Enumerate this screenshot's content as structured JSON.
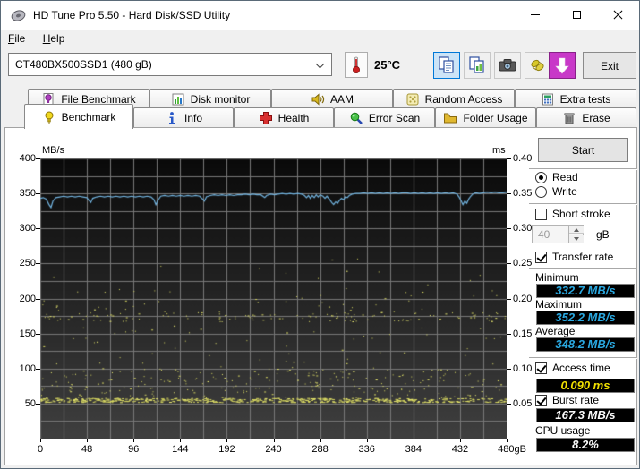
{
  "window": {
    "title": "HD Tune Pro 5.50 - Hard Disk/SSD Utility"
  },
  "menu": {
    "items": [
      "File",
      "Help"
    ]
  },
  "toolbar": {
    "device_select": {
      "value": "CT480BX500SSD1 (480 gB)"
    },
    "temperature": "25°C",
    "buttons": [
      "copy-icon",
      "copy-image-icon",
      "camera-icon",
      "hands-icon",
      "download-icon"
    ],
    "exit_label": "Exit"
  },
  "tabs": {
    "back_row": [
      {
        "label": "File Benchmark",
        "icon": "file-benchmark-icon"
      },
      {
        "label": "Disk monitor",
        "icon": "disk-monitor-icon"
      },
      {
        "label": "AAM",
        "icon": "aam-icon"
      },
      {
        "label": "Random Access",
        "icon": "random-access-icon"
      },
      {
        "label": "Extra tests",
        "icon": "extra-tests-icon"
      }
    ],
    "front_row": [
      {
        "label": "Benchmark",
        "icon": "benchmark-icon",
        "active": true
      },
      {
        "label": "Info",
        "icon": "info-icon"
      },
      {
        "label": "Health",
        "icon": "health-icon"
      },
      {
        "label": "Error Scan",
        "icon": "error-scan-icon"
      },
      {
        "label": "Folder Usage",
        "icon": "folder-usage-icon"
      },
      {
        "label": "Erase",
        "icon": "erase-icon"
      }
    ]
  },
  "controls": {
    "start_label": "Start",
    "read_label": "Read",
    "write_label": "Write",
    "read_selected": true,
    "short_stroke": {
      "label": "Short stroke",
      "checked": false,
      "size_value": "40",
      "size_unit": "gB"
    },
    "transfer_rate": {
      "label": "Transfer rate",
      "checked": true
    },
    "minimum": {
      "label": "Minimum",
      "value": "332.7 MB/s"
    },
    "maximum": {
      "label": "Maximum",
      "value": "352.2 MB/s"
    },
    "average": {
      "label": "Average",
      "value": "348.2 MB/s"
    },
    "access_time": {
      "label": "Access time",
      "checked": true,
      "value": "0.090 ms"
    },
    "burst_rate": {
      "label": "Burst rate",
      "checked": true,
      "value": "167.3 MB/s"
    },
    "cpu_usage": {
      "label": "CPU usage",
      "value": "8.2%"
    }
  },
  "chart_data": {
    "type": "line",
    "title": "",
    "x_axis": {
      "min": 0,
      "max": 480,
      "ticks": [
        0,
        48,
        96,
        144,
        192,
        240,
        288,
        336,
        384,
        432,
        480
      ],
      "unit": "gB",
      "grid_step": 24
    },
    "y_axis_left": {
      "label": "MB/s",
      "min": 0,
      "max": 400,
      "ticks": [
        400,
        350,
        300,
        250,
        200,
        150,
        100,
        50
      ],
      "grid_step": 25
    },
    "y_axis_right": {
      "label": "ms",
      "min": 0,
      "max": 0.4,
      "tick_labels": [
        "0.40",
        "0.35",
        "0.30",
        "0.25",
        "0.20",
        "0.15",
        "0.10",
        "0.05"
      ]
    },
    "grid": true,
    "legend": "none",
    "colors": {
      "plot_bg_top": "#0a0a0a",
      "plot_bg_bottom": "#3f3f3f",
      "grid": "#787878",
      "transfer_line": "#72b4e0",
      "access_dots": "#d8d860"
    },
    "series": [
      {
        "name": "transfer_rate",
        "type": "line",
        "unit": "MB/s",
        "color": "#72b4e0",
        "points": [
          [
            0,
            343
          ],
          [
            3,
            344
          ],
          [
            6,
            342
          ],
          [
            9,
            334
          ],
          [
            11,
            330
          ],
          [
            13,
            339
          ],
          [
            16,
            344
          ],
          [
            20,
            345
          ],
          [
            24,
            346
          ],
          [
            28,
            345
          ],
          [
            32,
            346
          ],
          [
            36,
            345
          ],
          [
            40,
            346
          ],
          [
            44,
            345
          ],
          [
            48,
            344
          ],
          [
            50,
            340
          ],
          [
            52,
            337
          ],
          [
            54,
            343
          ],
          [
            58,
            345
          ],
          [
            62,
            346
          ],
          [
            66,
            345
          ],
          [
            70,
            346
          ],
          [
            74,
            345
          ],
          [
            78,
            346
          ],
          [
            82,
            345
          ],
          [
            86,
            346
          ],
          [
            90,
            345
          ],
          [
            94,
            346
          ],
          [
            98,
            345
          ],
          [
            102,
            346
          ],
          [
            106,
            345
          ],
          [
            110,
            346
          ],
          [
            114,
            345
          ],
          [
            117,
            341
          ],
          [
            119,
            334
          ],
          [
            121,
            340
          ],
          [
            124,
            346
          ],
          [
            128,
            347
          ],
          [
            132,
            346
          ],
          [
            136,
            347
          ],
          [
            140,
            346
          ],
          [
            144,
            347
          ],
          [
            148,
            346
          ],
          [
            152,
            347
          ],
          [
            156,
            346
          ],
          [
            160,
            347
          ],
          [
            164,
            346
          ],
          [
            167,
            342
          ],
          [
            169,
            339
          ],
          [
            171,
            345
          ],
          [
            175,
            347
          ],
          [
            179,
            348
          ],
          [
            183,
            347
          ],
          [
            187,
            348
          ],
          [
            191,
            347
          ],
          [
            195,
            348
          ],
          [
            199,
            347
          ],
          [
            203,
            348
          ],
          [
            207,
            348
          ],
          [
            211,
            349
          ],
          [
            215,
            348
          ],
          [
            219,
            349
          ],
          [
            223,
            348
          ],
          [
            227,
            348
          ],
          [
            231,
            344
          ],
          [
            233,
            347
          ],
          [
            237,
            349
          ],
          [
            241,
            348
          ],
          [
            245,
            349
          ],
          [
            249,
            350
          ],
          [
            253,
            349
          ],
          [
            257,
            350
          ],
          [
            261,
            349
          ],
          [
            265,
            350
          ],
          [
            269,
            349
          ],
          [
            272,
            347
          ],
          [
            274,
            344
          ],
          [
            276,
            347
          ],
          [
            278,
            343
          ],
          [
            280,
            347
          ],
          [
            282,
            344
          ],
          [
            284,
            348
          ],
          [
            286,
            345
          ],
          [
            288,
            348
          ],
          [
            291,
            346
          ],
          [
            293,
            343
          ],
          [
            295,
            346
          ],
          [
            298,
            341
          ],
          [
            300,
            337
          ],
          [
            302,
            334
          ],
          [
            304,
            338
          ],
          [
            306,
            336
          ],
          [
            308,
            340
          ],
          [
            310,
            343
          ],
          [
            312,
            341
          ],
          [
            314,
            345
          ],
          [
            316,
            344
          ],
          [
            318,
            347
          ],
          [
            321,
            349
          ],
          [
            325,
            350
          ],
          [
            329,
            350
          ],
          [
            333,
            351
          ],
          [
            337,
            350
          ],
          [
            341,
            351
          ],
          [
            345,
            350
          ],
          [
            349,
            351
          ],
          [
            353,
            350
          ],
          [
            357,
            351
          ],
          [
            361,
            350
          ],
          [
            365,
            351
          ],
          [
            369,
            350
          ],
          [
            373,
            351
          ],
          [
            377,
            351
          ],
          [
            381,
            350
          ],
          [
            385,
            351
          ],
          [
            389,
            350
          ],
          [
            393,
            351
          ],
          [
            397,
            350
          ],
          [
            401,
            351
          ],
          [
            405,
            350
          ],
          [
            409,
            351
          ],
          [
            413,
            350
          ],
          [
            417,
            351
          ],
          [
            421,
            350
          ],
          [
            425,
            351
          ],
          [
            429,
            349
          ],
          [
            431,
            345
          ],
          [
            433,
            340
          ],
          [
            435,
            334
          ],
          [
            437,
            339
          ],
          [
            439,
            336
          ],
          [
            441,
            342
          ],
          [
            443,
            346
          ],
          [
            445,
            349
          ],
          [
            448,
            351
          ],
          [
            452,
            350
          ],
          [
            456,
            351
          ],
          [
            460,
            352
          ],
          [
            464,
            351
          ],
          [
            468,
            352
          ],
          [
            472,
            351
          ],
          [
            476,
            351
          ],
          [
            480,
            352
          ]
        ]
      },
      {
        "name": "access_time",
        "type": "scatter",
        "unit": "ms",
        "color": "#d8d860",
        "seed": 7,
        "scatter_bands": [
          {
            "y_min": 52,
            "y_max": 58,
            "count": 500,
            "dash": true
          },
          {
            "y_min": 58,
            "y_max": 72,
            "count": 70
          },
          {
            "y_min": 72,
            "y_max": 100,
            "count": 160
          },
          {
            "y_min": 100,
            "y_max": 165,
            "count": 55
          },
          {
            "y_min": 167,
            "y_max": 181,
            "count": 130
          },
          {
            "y_min": 181,
            "y_max": 215,
            "count": 45
          },
          {
            "y_min": 215,
            "y_max": 262,
            "count": 12
          }
        ]
      }
    ],
    "stats": {
      "minimum_mbs": 332.7,
      "maximum_mbs": 352.2,
      "average_mbs": 348.2,
      "access_time_ms": 0.09,
      "burst_rate_mbs": 167.3,
      "cpu_usage_pct": 8.2
    }
  }
}
